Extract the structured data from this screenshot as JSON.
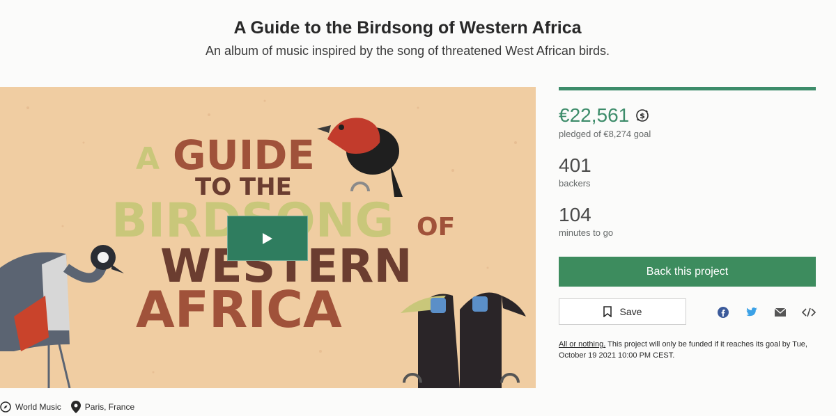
{
  "header": {
    "title": "A Guide to the Birdsong of Western Africa",
    "subtitle": "An album of music inspired by the song of threatened West African birds."
  },
  "video": {
    "artwork_lines": [
      "A",
      "GUIDE",
      "TO THE",
      "BIRDSONG",
      "OF",
      "WESTERN",
      "AFRICA"
    ],
    "play_icon": "play-icon"
  },
  "meta": {
    "category": "World Music",
    "location": "Paris, France",
    "category_icon": "compass-icon",
    "location_icon": "map-pin-icon"
  },
  "stats": {
    "progress_fraction": 1.0,
    "pledged": "€22,561",
    "pledged_label": "pledged of €8,274 goal",
    "currency_icon": "currency-conversion-icon",
    "backers": "401",
    "backers_label": "backers",
    "minutes": "104",
    "minutes_label": "minutes to go"
  },
  "actions": {
    "back_label": "Back this project",
    "save_label": "Save",
    "save_icon": "bookmark-icon",
    "share_icons": [
      "facebook-icon",
      "twitter-icon",
      "email-icon",
      "embed-icon"
    ]
  },
  "funding_note": {
    "link": "All or nothing.",
    "text": " This project will only be funded if it reaches its goal by Tue, October 19 2021 10:00 PM CEST."
  },
  "colors": {
    "accent": "#3d8c6a",
    "button": "#3d8c5e"
  }
}
